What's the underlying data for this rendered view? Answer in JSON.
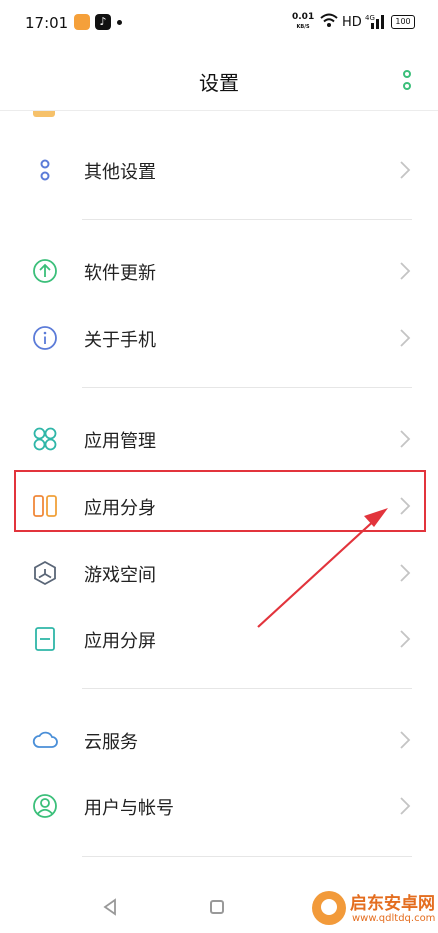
{
  "status_bar": {
    "time": "17:01",
    "net_speed": "0.01",
    "net_unit": "KB/S",
    "hd": "HD",
    "network": "4G",
    "battery": "100"
  },
  "header": {
    "title": "设置"
  },
  "sections": [
    [
      {
        "label": "其他设置",
        "icon": "dots-vertical-icon"
      }
    ],
    [
      {
        "label": "软件更新",
        "icon": "arrow-up-circle-icon"
      },
      {
        "label": "关于手机",
        "icon": "info-circle-icon"
      }
    ],
    [
      {
        "label": "应用管理",
        "icon": "apps-grid-icon"
      },
      {
        "label": "应用分身",
        "icon": "dual-app-icon",
        "highlighted": true
      },
      {
        "label": "游戏空间",
        "icon": "game-space-icon"
      },
      {
        "label": "应用分屏",
        "icon": "split-screen-icon"
      }
    ],
    [
      {
        "label": "云服务",
        "icon": "cloud-icon"
      },
      {
        "label": "用户与帐号",
        "icon": "user-account-icon"
      }
    ]
  ],
  "watermark": {
    "name": "启东安卓网",
    "url": "www.qdltdq.com"
  },
  "colors": {
    "highlight": "#e2343c",
    "accent_green": "#3bbf7a",
    "accent_orange": "#f0883a"
  }
}
